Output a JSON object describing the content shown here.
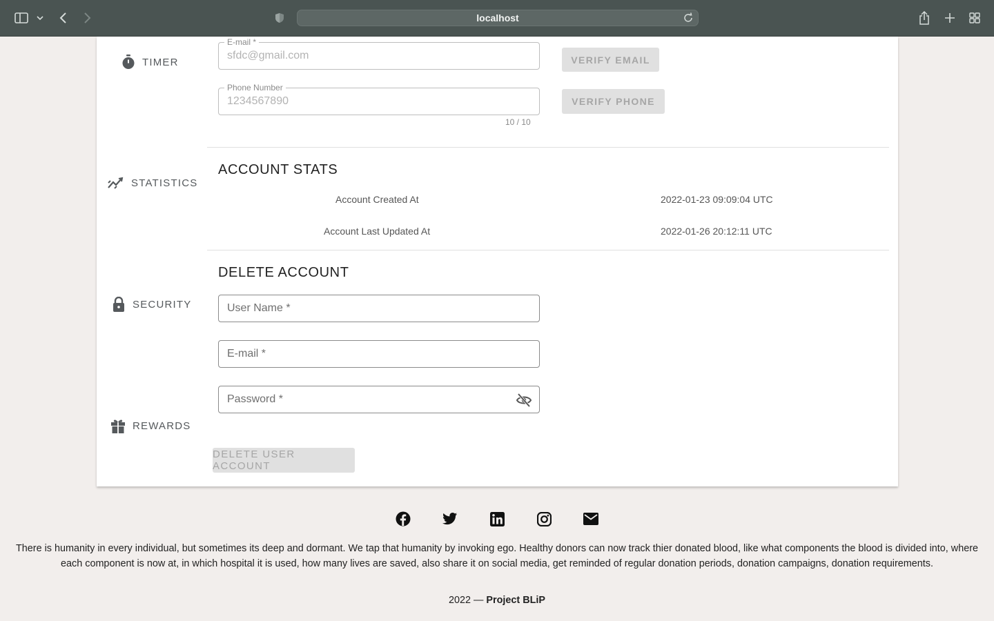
{
  "browser": {
    "url": "localhost"
  },
  "sidebar": {
    "items": [
      {
        "label": "TIMER",
        "icon": "timer-icon"
      },
      {
        "label": "STATISTICS",
        "icon": "statistics-icon"
      },
      {
        "label": "SECURITY",
        "icon": "lock-icon"
      },
      {
        "label": "REWARDS",
        "icon": "gift-icon"
      }
    ]
  },
  "contact": {
    "email_label": "E-mail *",
    "email_value": "sfdc@gmail.com",
    "phone_label": "Phone Number",
    "phone_value": "1234567890",
    "phone_counter": "10 / 10",
    "verify_email_label": "VERIFY EMAIL",
    "verify_phone_label": "VERIFY PHONE"
  },
  "stats": {
    "title": "ACCOUNT STATS",
    "rows": [
      {
        "label": "Account Created At",
        "value": "2022-01-23 09:09:04 UTC"
      },
      {
        "label": "Account Last Updated At",
        "value": "2022-01-26 20:12:11 UTC"
      }
    ]
  },
  "delete_account": {
    "title": "DELETE ACCOUNT",
    "username_placeholder": "User Name *",
    "email_placeholder": "E-mail *",
    "password_placeholder": "Password *",
    "submit_label": "DELETE USER ACCOUNT"
  },
  "footer": {
    "social_icons": [
      "facebook-icon",
      "twitter-icon",
      "linkedin-icon",
      "instagram-icon",
      "mail-icon"
    ],
    "description": "There is humanity in every individual, but sometimes its deep and dormant. We tap that humanity by invoking ego. Healthy donors can now track thier donated blood, like what components the blood is divided into, where each component is now at, in which hospital it is used, how many lives are saved, also share it on social media, get reminded of regular donation periods, donation campaigns, donation requirements.",
    "copyright_prefix": "2022 — ",
    "brand": "Project BLiP"
  },
  "colors": {
    "chrome": "#4a5452",
    "page_bg": "#f2eeec",
    "card_bg": "#ffffff",
    "disabled_button": "#e0e0e0"
  }
}
